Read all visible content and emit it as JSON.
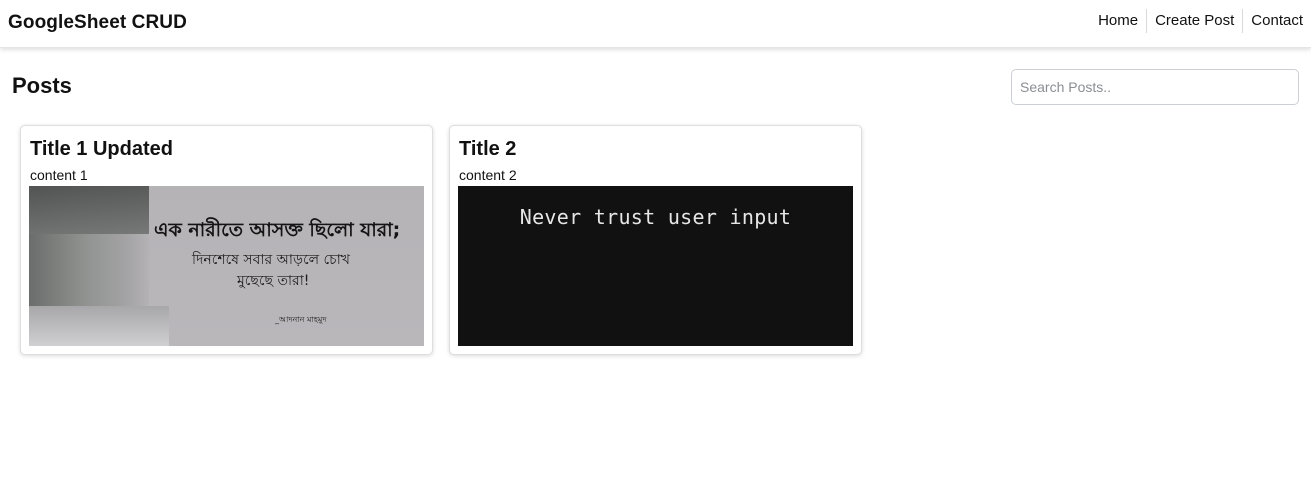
{
  "navbar": {
    "brand": "GoogleSheet CRUD",
    "links": [
      "Home",
      "Create Post",
      "Contact"
    ]
  },
  "page": {
    "title": "Posts",
    "search_placeholder": "Search Posts.."
  },
  "posts": [
    {
      "title": "Title 1 Updated",
      "content": "content 1",
      "image_text": [
        "এক নারীতে আসক্ত ছিলো যারা;",
        "দিনশেষে সবার আড়লে চোখ",
        "মুছেছে তারা!",
        "_আদনান মাহমুদ"
      ]
    },
    {
      "title": "Title 2",
      "content": "content 2",
      "image_text": [
        "Never trust user input"
      ]
    }
  ],
  "colors": {
    "background": "#ffffff",
    "text": "#111111",
    "card_border": "#dedede",
    "code_bg": "#111111"
  }
}
